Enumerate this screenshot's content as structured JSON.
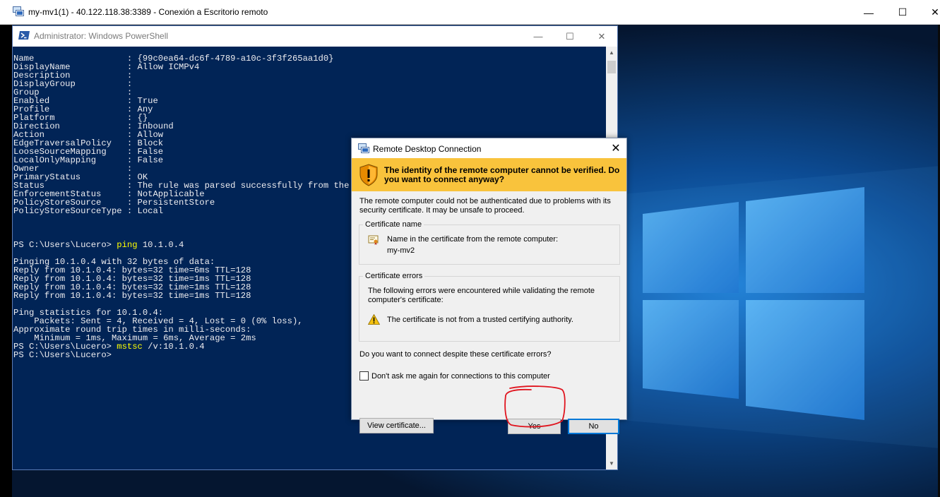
{
  "rdp_window": {
    "title": "my-mv1(1) - 40.122.118.38:3389 - Conexión a Escritorio remoto",
    "controls": {
      "minimize": "—",
      "maximize": "☐",
      "close": "✕"
    }
  },
  "powershell": {
    "title": "Administrator: Windows PowerShell",
    "controls": {
      "minimize": "—",
      "maximize": "☐",
      "close": "✕"
    },
    "lines": [
      "Name                  : {99c0ea64-dc6f-4789-a10c-3f3f265aa1d0}",
      "DisplayName           : Allow ICMPv4",
      "Description           :",
      "DisplayGroup          :",
      "Group                 :",
      "Enabled               : True",
      "Profile               : Any",
      "Platform              : {}",
      "Direction             : Inbound",
      "Action                : Allow",
      "EdgeTraversalPolicy   : Block",
      "LooseSourceMapping    : False",
      "LocalOnlyMapping      : False",
      "Owner                 :",
      "PrimaryStatus         : OK",
      "Status                : The rule was parsed successfully from the sto",
      "EnforcementStatus     : NotApplicable",
      "PolicyStoreSource     : PersistentStore",
      "PolicyStoreSourceType : Local",
      "",
      "",
      "",
      "PS C:\\Users\\Lucero> ",
      "",
      "Pinging 10.1.0.4 with 32 bytes of data:",
      "Reply from 10.1.0.4: bytes=32 time=6ms TTL=128",
      "Reply from 10.1.0.4: bytes=32 time=1ms TTL=128",
      "Reply from 10.1.0.4: bytes=32 time=1ms TTL=128",
      "Reply from 10.1.0.4: bytes=32 time=1ms TTL=128",
      "",
      "Ping statistics for 10.1.0.4:",
      "    Packets: Sent = 4, Received = 4, Lost = 0 (0% loss),",
      "Approximate round trip times in milli-seconds:",
      "    Minimum = 1ms, Maximum = 6ms, Average = 2ms",
      "PS C:\\Users\\Lucero> ",
      "PS C:\\Users\\Lucero>"
    ],
    "cmd1_name": "ping",
    "cmd1_args": " 10.1.0.4",
    "cmd2_name": "mstsc",
    "cmd2_args": " /v:10.1.0.4",
    "scroll_up": "▲",
    "scroll_down": "▼"
  },
  "dialog": {
    "title": "Remote Desktop Connection",
    "close": "✕",
    "warning": "The identity of the remote computer cannot be verified. Do you want to connect anyway?",
    "intro_line1": "The remote computer could not be authenticated due to problems with its",
    "intro_line2": "security certificate. It may be unsafe to proceed.",
    "cert_name_group": "Certificate name",
    "cert_name_label": "Name in the certificate from the remote computer:",
    "cert_name_value": "my-mv2",
    "cert_errors_group": "Certificate errors",
    "errors_intro_line1": "The following errors were encountered while validating the remote",
    "errors_intro_line2": "computer's certificate:",
    "error_item": "The certificate is not from a trusted certifying authority.",
    "question": "Do you want to connect despite these certificate errors?",
    "dont_ask": "Don't ask me again for connections to this computer",
    "view_cert": "View certificate...",
    "yes": "Yes",
    "no": "No"
  },
  "colors": {
    "powershell_bg": "#012456",
    "warning_banner": "#f9c33c",
    "highlight_circle": "#e0141e"
  }
}
